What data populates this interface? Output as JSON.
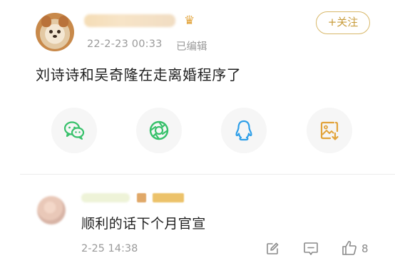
{
  "post": {
    "timestamp": "22-2-23 00:33",
    "edited_label": "已编辑",
    "follow_label": "+关注",
    "text": "刘诗诗和吴奇隆在走离婚程序了",
    "crown_glyph": "♛"
  },
  "share": {
    "buttons": [
      {
        "icon": "wechat-icon",
        "color": "#38c16b"
      },
      {
        "icon": "moments-icon",
        "color": "#38c16b"
      },
      {
        "icon": "qq-icon",
        "color": "#2f9fe8"
      },
      {
        "icon": "save-image-icon",
        "color": "#e2a33a"
      }
    ]
  },
  "comment": {
    "text": "顺利的话下个月官宣",
    "time": "2-25 14:38",
    "like_count": "8",
    "icons": [
      "edit-icon",
      "reply-icon",
      "thumbs-up-icon"
    ]
  },
  "colors": {
    "accent": "#c79b3a",
    "secondary_text": "#9a9a9a",
    "wechat_green": "#38c16b",
    "qq_blue": "#2f9fe8"
  }
}
